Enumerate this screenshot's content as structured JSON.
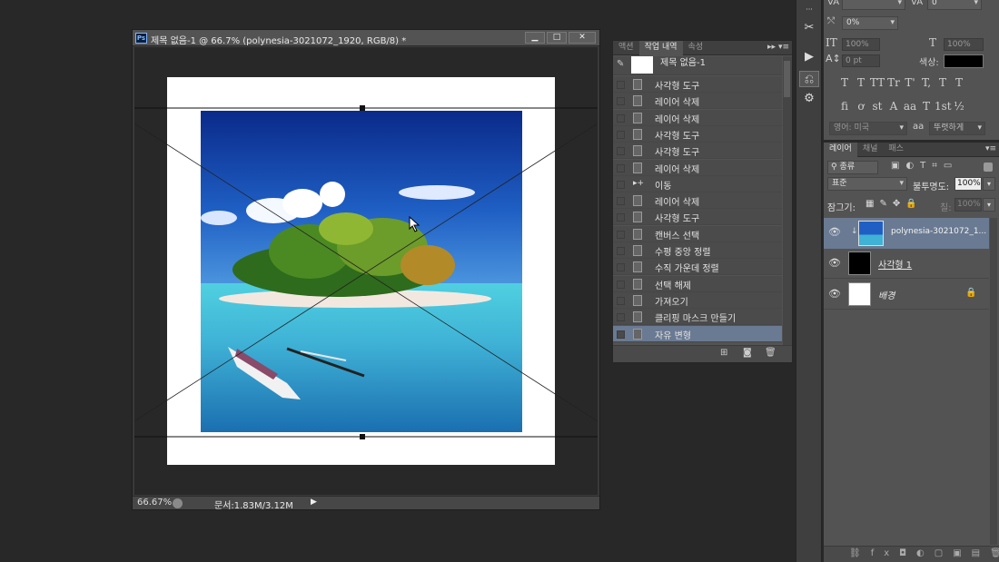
{
  "document": {
    "title": "제목 없음-1 @ 66.7% (polynesia-3021072_1920, RGB/8) *",
    "ps_icon": "Ps",
    "zoom": "66.67%",
    "doc_size": "문서:1.83M/3.12M",
    "window_buttons": {
      "minimize": "▁",
      "maximize": "□",
      "close": "✕"
    }
  },
  "history_panel": {
    "tabs": [
      "액션",
      "작업 내역",
      "속성"
    ],
    "active_tab": 1,
    "snapshot_label": "제목 없음-1",
    "items": [
      {
        "label": "사각형 도구"
      },
      {
        "label": "레이어 삭제"
      },
      {
        "label": "레이어 삭제"
      },
      {
        "label": "사각형 도구"
      },
      {
        "label": "사각형 도구"
      },
      {
        "label": "레이어 삭제"
      },
      {
        "label": "이동"
      },
      {
        "label": "레이어 삭제"
      },
      {
        "label": "사각형 도구"
      },
      {
        "label": "캔버스 선택"
      },
      {
        "label": "수평 중앙 정렬"
      },
      {
        "label": "수직 가운데 정렬"
      },
      {
        "label": "선택 해제"
      },
      {
        "label": "가져오기"
      },
      {
        "label": "클리핑 마스크 만들기"
      },
      {
        "label": "자유 변형"
      }
    ],
    "selected_index": 15
  },
  "character_panel": {
    "kerning_value": "0",
    "scale_percent": "0%",
    "vertical_scale": "100%",
    "horizontal_scale": "100%",
    "baseline": "0 pt",
    "color_label": "색상:",
    "language": "영어: 미국",
    "antialias_label": "aa",
    "antialias": "뚜렷하게",
    "style_buttons": [
      "T",
      "T",
      "TT",
      "Tr",
      "T'",
      "T,",
      "T",
      "T"
    ],
    "opentype_buttons": [
      "fi",
      "ơ",
      "st",
      "A",
      "aa",
      "T",
      "1st",
      "½"
    ]
  },
  "layers_panel": {
    "tabs": [
      "레이어",
      "채널",
      "패스"
    ],
    "filter": "종류",
    "blend_mode": "표준",
    "opacity_label": "불투명도:",
    "opacity": "100%",
    "lock_label": "잠그기:",
    "fill_label": "칠:",
    "fill": "100%",
    "layers": [
      {
        "name": "polynesia-3021072_1...",
        "selected": true
      },
      {
        "name": "사각형 1",
        "selected": false
      },
      {
        "name": "배경",
        "selected": false
      }
    ]
  },
  "colors": {
    "selection": "#6a7a93",
    "panel": "#535353",
    "background": "#282828"
  }
}
